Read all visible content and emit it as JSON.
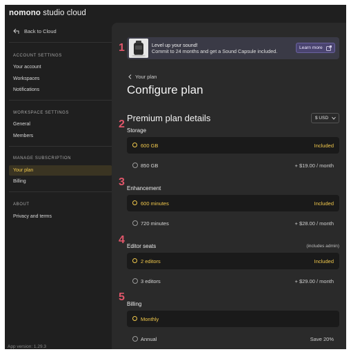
{
  "app": {
    "brand_light": "nomono",
    "brand_rest": " studio cloud",
    "version": "App version: 1.29.3"
  },
  "sidebar": {
    "back_label": "Back to Cloud",
    "sections": [
      {
        "heading": "ACCOUNT SETTINGS",
        "items": [
          "Your account",
          "Workspaces",
          "Notifications"
        ]
      },
      {
        "heading": "WORKSPACE SETTINGS",
        "items": [
          "General",
          "Members"
        ]
      },
      {
        "heading": "MANAGE SUBSCRIPTION",
        "items": [
          "Your plan",
          "Billing"
        ]
      },
      {
        "heading": "ABOUT",
        "items": [
          "Privacy and terms"
        ]
      }
    ],
    "active_item": "Your plan"
  },
  "promo": {
    "title": "Level up your sound!",
    "body": "Commit to 24 months and get a Sound Capsule included.",
    "button": "Learn more",
    "icon": "external-link-icon"
  },
  "breadcrumb": "Your plan",
  "page_title": "Configure plan",
  "plan_title": "Premium plan details",
  "currency": "$ USD",
  "sections": [
    {
      "label": "Storage",
      "note": "",
      "options": [
        {
          "label": "600 GB",
          "price": "Included",
          "selected": true
        },
        {
          "label": "850 GB",
          "price": "+ $19.00 / month",
          "selected": false
        }
      ]
    },
    {
      "label": "Enhancement",
      "note": "",
      "options": [
        {
          "label": "600 minutes",
          "price": "Included",
          "selected": true
        },
        {
          "label": "720 minutes",
          "price": "+ $28.00 / month",
          "selected": false
        }
      ]
    },
    {
      "label": "Editor seats",
      "note": "(includes admin)",
      "options": [
        {
          "label": "2 editors",
          "price": "Included",
          "selected": true
        },
        {
          "label": "3 editors",
          "price": "+ $29.00 / month",
          "selected": false
        }
      ]
    },
    {
      "label": "Billing",
      "note": "",
      "options": [
        {
          "label": "Monthly",
          "price": "",
          "selected": true
        },
        {
          "label": "Annual",
          "price": "Save 20%",
          "selected": false
        }
      ]
    }
  ],
  "annotations": [
    "1",
    "2",
    "3",
    "4",
    "5"
  ],
  "colors": {
    "accent": "#f2c94c",
    "annotation": "#e0566a",
    "promo_bg": "#3a3a46"
  }
}
